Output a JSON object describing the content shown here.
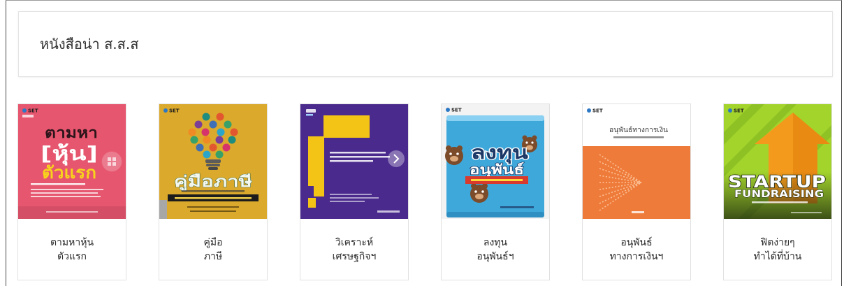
{
  "page": {
    "section_title": "หนังสือน่า ส.ส.ส"
  },
  "colors": {
    "page_background": "#ffffff",
    "card_border": "#e1e1e1",
    "frame_border": "#4a4a4a",
    "text": "#2b2b2b"
  },
  "books": [
    {
      "caption": [
        "ตามหาหุ้น",
        "ตัวแรก"
      ],
      "cover": {
        "publisher": "SET",
        "title_lines": [
          "ตามหา",
          "[หุ้น]",
          "ตัวแรก"
        ],
        "bg_color": "#e6566e"
      }
    },
    {
      "caption": [
        "คู่มือ",
        "ภาษี"
      ],
      "cover": {
        "publisher": "SET",
        "title": "คู่มือภาษี",
        "bg_color": "#dba92b"
      }
    },
    {
      "caption": [
        "วิเคราะห์",
        "เศรษฐกิจฯ"
      ],
      "cover": {
        "bg_color": "#4a2a8d",
        "accent_color": "#f3c316"
      }
    },
    {
      "caption": [
        "ลงทุน",
        "อนุพันธ์ฯ"
      ],
      "cover": {
        "publisher": "SET",
        "title_lines": [
          "ลงทุน",
          "อนุพันธ์"
        ],
        "bg_color": "#3fa8db"
      }
    },
    {
      "caption": [
        "อนุพันธ์",
        "ทางการเงินฯ"
      ],
      "cover": {
        "publisher": "SET",
        "title": "อนุพันธ์ทางการเงิน",
        "bg_color": "#ef7b3a"
      }
    },
    {
      "caption": [
        "ฟิตง่ายๆ",
        "ทำได้ที่บ้าน"
      ],
      "cover": {
        "publisher": "SET",
        "title_lines": [
          "STARTUP",
          "FUNDRAISING"
        ],
        "bg_color": "#a3d42c"
      }
    }
  ]
}
